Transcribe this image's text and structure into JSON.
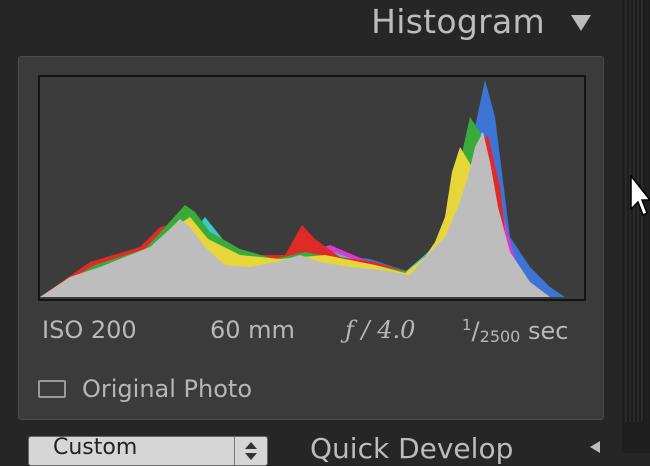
{
  "panel": {
    "title": "Histogram",
    "collapse_icon": "triangle-down-icon"
  },
  "exif": {
    "iso": "ISO 200",
    "focal_length": "60 mm",
    "aperture": "ƒ / 4.0",
    "shutter_numerator": "1",
    "shutter_slash": "/",
    "shutter_denominator": "2500",
    "shutter_unit": "sec"
  },
  "original_photo": {
    "label": "Original Photo",
    "checked": false
  },
  "quick_develop": {
    "preset_value": "Custom",
    "title": "Quick Develop",
    "collapse_icon": "triangle-left-icon"
  },
  "colors": {
    "luminance": "#bdbdbd",
    "red": "#e02a2a",
    "green": "#3aaa3a",
    "blue": "#3d74d6",
    "yellow": "#e7d63a",
    "magenta": "#d63ad0",
    "cyan": "#3ac8c8"
  }
}
